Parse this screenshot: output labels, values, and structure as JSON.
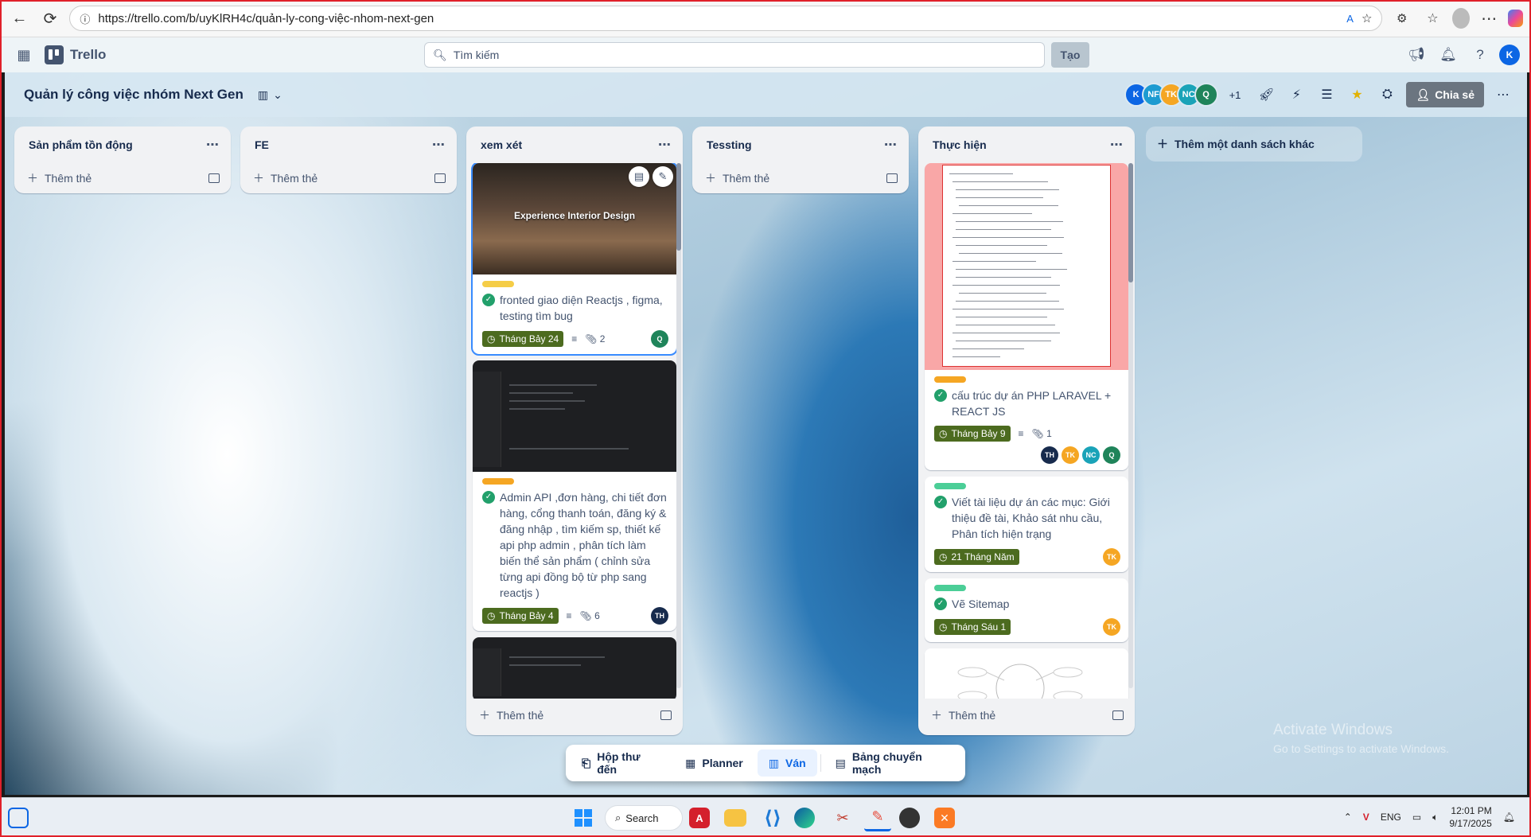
{
  "browser": {
    "url": "https://trello.com/b/uyKlRH4c/quản-ly-cong-việc-nhom-next-gen"
  },
  "header": {
    "brand": "Trello",
    "search_placeholder": "Tìm kiếm",
    "create_label": "Tạo",
    "user_initial": "K"
  },
  "board": {
    "title": "Quản lý công việc nhóm Next Gen",
    "members": [
      {
        "initials": "K",
        "color": "#0c66e4"
      },
      {
        "initials": "NF",
        "color": "#1d9bd1"
      },
      {
        "initials": "TK",
        "color": "#f5a623"
      },
      {
        "initials": "NC",
        "color": "#1aa3b8"
      },
      {
        "initials": "Q",
        "color": "#1f845a"
      }
    ],
    "members_more": "+1",
    "share_label": "Chia sẻ",
    "add_list_label": "Thêm một danh sách khác"
  },
  "lists": [
    {
      "title": "Sản phẩm tồn động",
      "add_label": "Thêm thẻ"
    },
    {
      "title": "FE",
      "add_label": "Thêm thẻ"
    },
    {
      "title": "xem xét",
      "add_label": "Thêm thẻ",
      "cards": [
        {
          "cover_text": "Experience Interior Design",
          "label_color": "#f5cd47",
          "title": "fronted giao diện Reactjs , figma, testing tìm bug",
          "due": "Tháng Bảy 24",
          "attachments": "2",
          "avatars": [
            {
              "i": "Q",
              "c": "#1f845a"
            }
          ]
        },
        {
          "label_color": "#f5a623",
          "title": "Admin API ,đơn hàng, chi tiết đơn hàng, cổng thanh toán, đăng ký & đăng nhập , tìm kiếm sp, thiết kế api php admin , phân tích làm biến thể sản phẩm ( chỉnh sửa từng api đồng bộ từ php sang reactjs )",
          "due": "Tháng Bảy 4",
          "attachments": "6",
          "avatars": [
            {
              "i": "TH",
              "c": "#172b4d"
            }
          ]
        }
      ]
    },
    {
      "title": "Tessting",
      "add_label": "Thêm thẻ"
    },
    {
      "title": "Thực hiện",
      "add_label": "Thêm thẻ",
      "cards": [
        {
          "label_color": "#f5a623",
          "title": "cấu trúc dự án PHP LARAVEL + REACT JS",
          "due": "Tháng Bảy 9",
          "attachments": "1",
          "avatars": [
            {
              "i": "TH",
              "c": "#172b4d"
            },
            {
              "i": "TK",
              "c": "#f5a623"
            },
            {
              "i": "NC",
              "c": "#1aa3b8"
            },
            {
              "i": "Q",
              "c": "#1f845a"
            }
          ]
        },
        {
          "label_color": "#4bce97",
          "title": "Viết tài liệu dự án các mục: Giới thiệu đề tài, Khảo sát nhu cầu, Phân tích hiện trạng",
          "due": "21 Tháng Năm",
          "avatars": [
            {
              "i": "TK",
              "c": "#f5a623"
            }
          ]
        },
        {
          "label_color": "#4bce97",
          "title": "Vẽ Sitemap",
          "due": "Tháng Sáu 1",
          "avatars": [
            {
              "i": "TK",
              "c": "#f5a623"
            }
          ]
        }
      ]
    }
  ],
  "switcher": {
    "inbox": "Hộp thư đến",
    "planner": "Planner",
    "board": "Ván",
    "switch": "Bảng chuyển mạch"
  },
  "watermark": {
    "line1": "Activate Windows",
    "line2": "Go to Settings to activate Windows."
  },
  "taskbar": {
    "search": "Search",
    "lang": "ENG",
    "time": "12:01 PM",
    "date": "9/17/2025"
  }
}
